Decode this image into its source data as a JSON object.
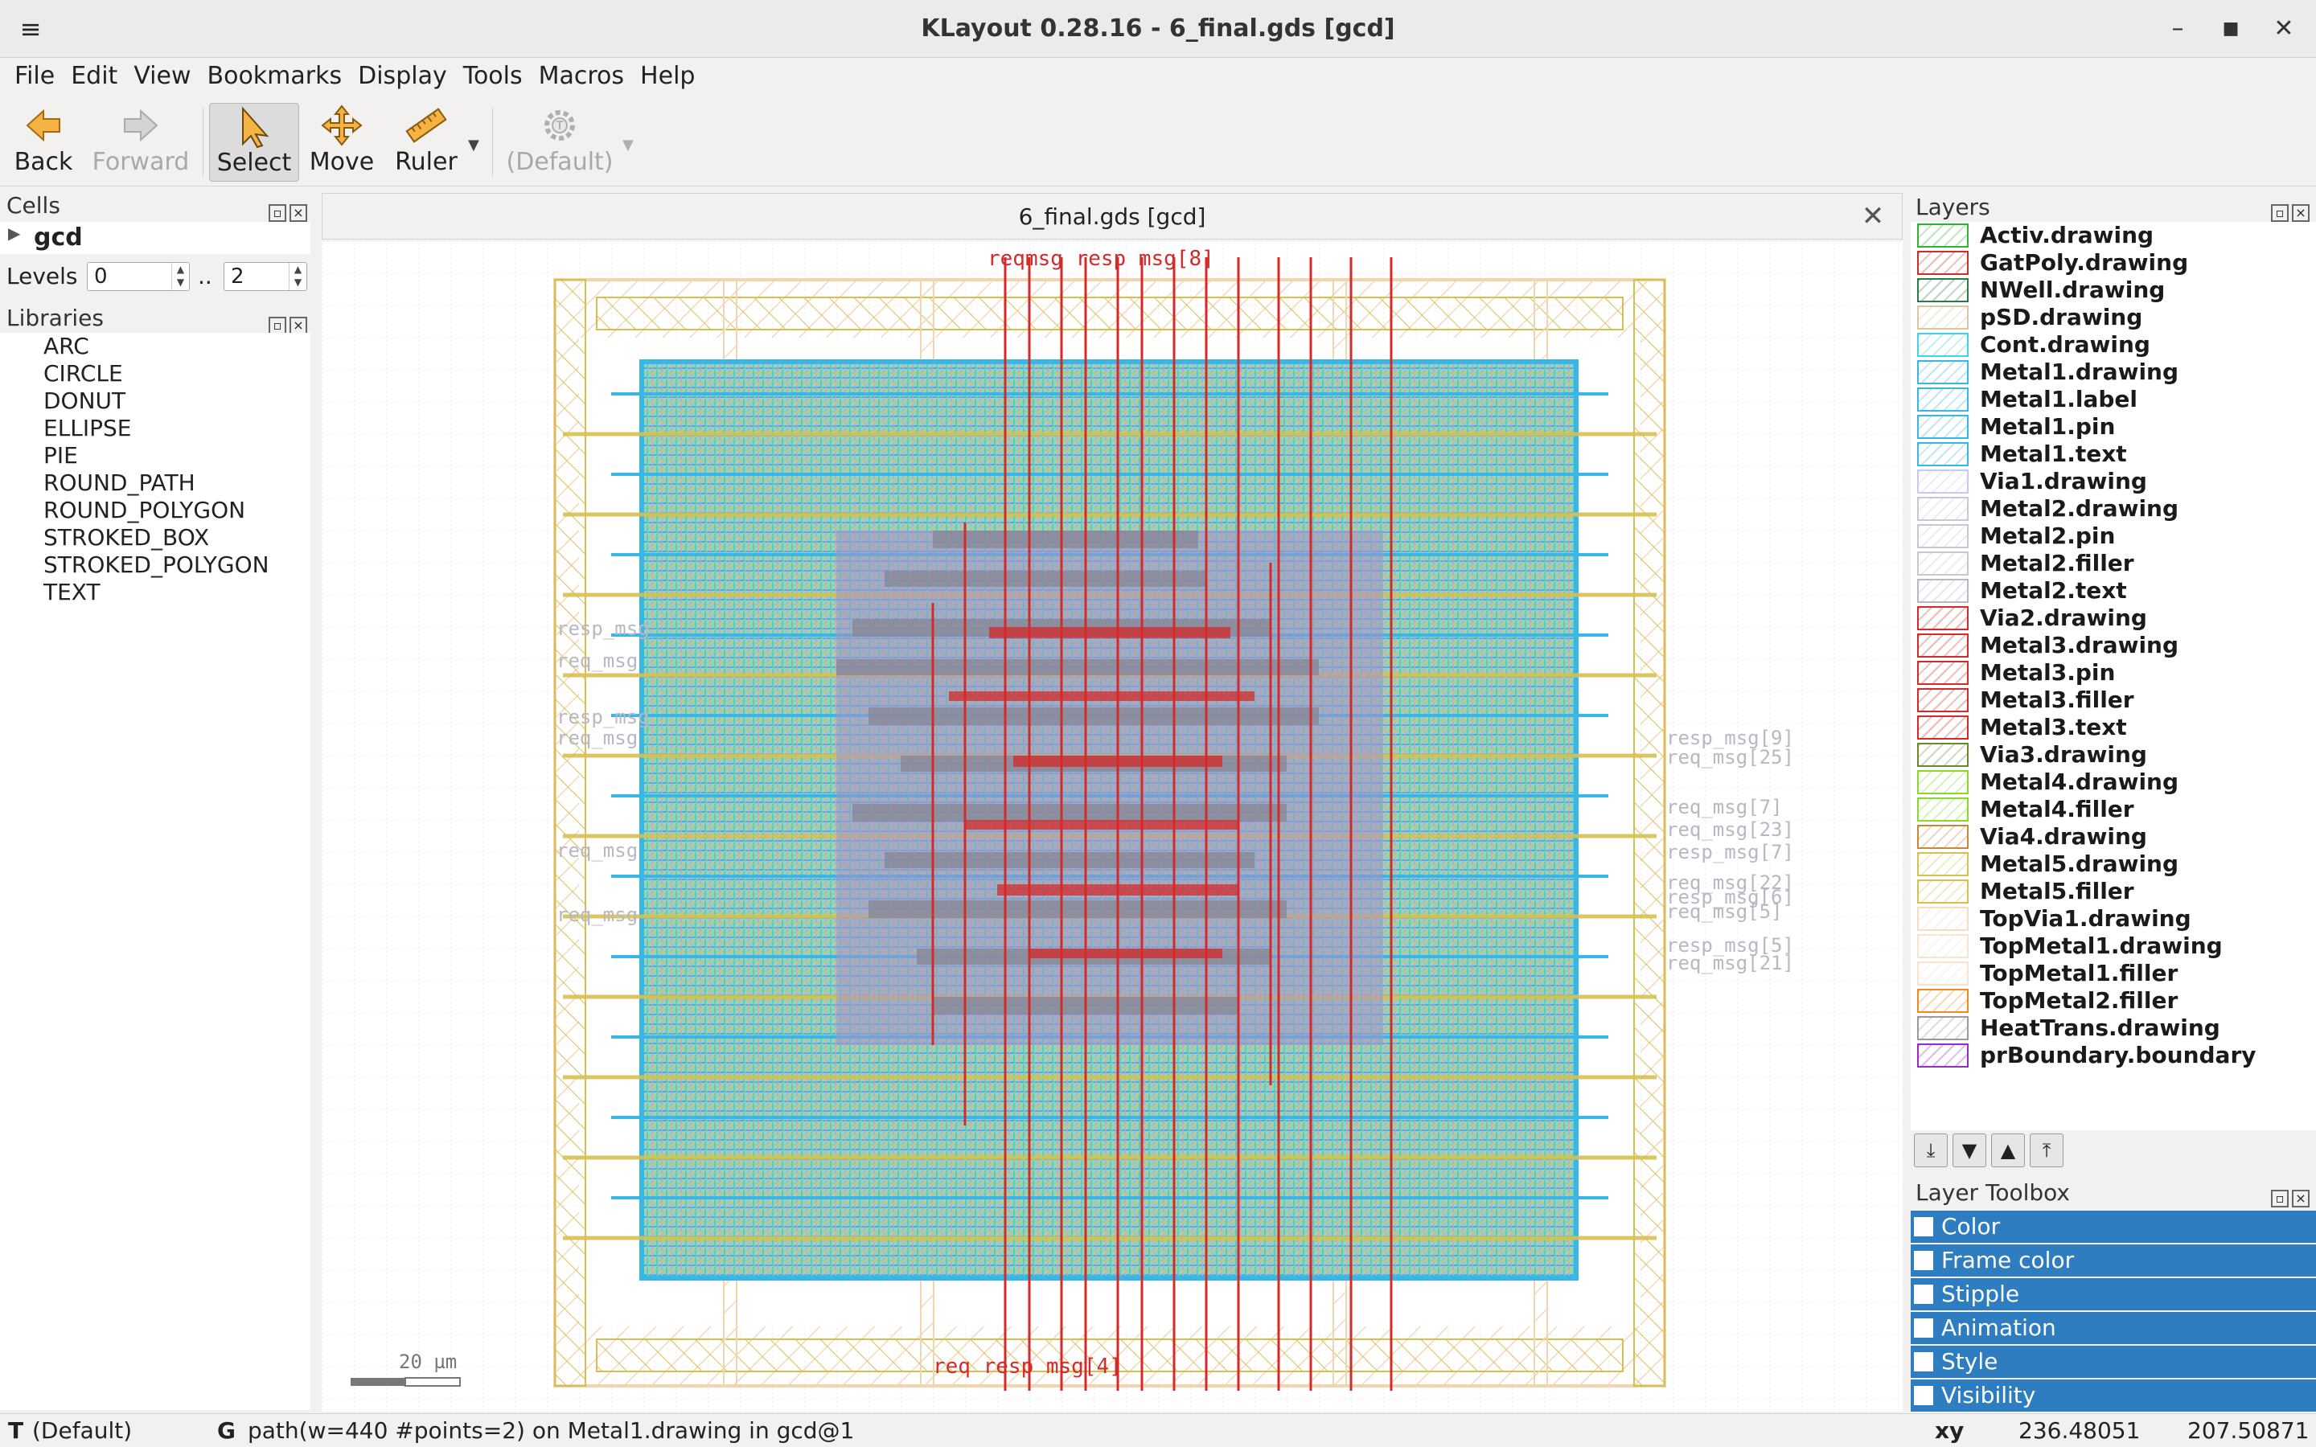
{
  "window": {
    "title": "KLayout 0.28.16 - 6_final.gds [gcd]"
  },
  "menu": [
    "File",
    "Edit",
    "View",
    "Bookmarks",
    "Display",
    "Tools",
    "Macros",
    "Help"
  ],
  "toolbar": {
    "back": "Back",
    "forward": "Forward",
    "select": "Select",
    "move": "Move",
    "ruler": "Ruler",
    "default": "(Default)"
  },
  "cells": {
    "title": "Cells",
    "root": "gcd"
  },
  "levels": {
    "label": "Levels",
    "from": "0",
    "sep": "..",
    "to": "2"
  },
  "libraries": {
    "title": "Libraries",
    "items": [
      "ARC",
      "CIRCLE",
      "DONUT",
      "ELLIPSE",
      "PIE",
      "ROUND_PATH",
      "ROUND_POLYGON",
      "STROKED_BOX",
      "STROKED_POLYGON",
      "TEXT"
    ]
  },
  "tab": {
    "title": "6_final.gds [gcd]"
  },
  "canvas": {
    "scale_label": "20 µm",
    "top_label": "reqmsg resp msg[8]",
    "bottom_label": "req resp msg[4]",
    "right_labels": [
      "resp_msg[9]",
      "req_msg[25]",
      "req_msg[7]",
      "req_msg[23]",
      "resp_msg[7]",
      "req_msg[22]",
      "resp_msg[6]",
      "req_msg[5]",
      "resp_msg[5]",
      "req_msg[21]"
    ],
    "left_labels": [
      "resp_msg",
      "req_msg",
      "resp_msg",
      "req_msg",
      "req_msg",
      "req_msg"
    ]
  },
  "layers": {
    "title": "Layers",
    "items": [
      {
        "name": "Activ.drawing",
        "color": "#2fb52f"
      },
      {
        "name": "GatPoly.drawing",
        "color": "#c8302a"
      },
      {
        "name": "NWell.drawing",
        "color": "#2a7a4c"
      },
      {
        "name": "pSD.drawing",
        "color": "#d8c7a0"
      },
      {
        "name": "Cont.drawing",
        "color": "#3fd4e6"
      },
      {
        "name": "Metal1.drawing",
        "color": "#38b6e8"
      },
      {
        "name": "Metal1.label",
        "color": "#38b6e8"
      },
      {
        "name": "Metal1.pin",
        "color": "#38b6e8"
      },
      {
        "name": "Metal1.text",
        "color": "#38b6e8"
      },
      {
        "name": "Via1.drawing",
        "color": "#c8c8f0"
      },
      {
        "name": "Metal2.drawing",
        "color": "#c8c8d4"
      },
      {
        "name": "Metal2.pin",
        "color": "#c8c8d4"
      },
      {
        "name": "Metal2.filler",
        "color": "#c8c8d4"
      },
      {
        "name": "Metal2.text",
        "color": "#b8b8c4"
      },
      {
        "name": "Via2.drawing",
        "color": "#d42a2a"
      },
      {
        "name": "Metal3.drawing",
        "color": "#d42a2a"
      },
      {
        "name": "Metal3.pin",
        "color": "#d42a2a"
      },
      {
        "name": "Metal3.filler",
        "color": "#d42a2a"
      },
      {
        "name": "Metal3.text",
        "color": "#d42a2a"
      },
      {
        "name": "Via3.drawing",
        "color": "#6a8a2a"
      },
      {
        "name": "Metal4.drawing",
        "color": "#8ad82a"
      },
      {
        "name": "Metal4.filler",
        "color": "#8ad82a"
      },
      {
        "name": "Via4.drawing",
        "color": "#c8883a"
      },
      {
        "name": "Metal5.drawing",
        "color": "#d8c050"
      },
      {
        "name": "Metal5.filler",
        "color": "#d8c050"
      },
      {
        "name": "TopVia1.drawing",
        "color": "#f4dcc0"
      },
      {
        "name": "TopMetal1.drawing",
        "color": "#f4e4d0"
      },
      {
        "name": "TopMetal1.filler",
        "color": "#f4e4d0"
      },
      {
        "name": "TopMetal2.filler",
        "color": "#f08a20"
      },
      {
        "name": "HeatTrans.drawing",
        "color": "#9a9a9a"
      },
      {
        "name": "prBoundary.boundary",
        "color": "#9a2ad0"
      }
    ]
  },
  "layer_toolbox": {
    "title": "Layer Toolbox",
    "items": [
      "Color",
      "Frame color",
      "Stipple",
      "Animation",
      "Style",
      "Visibility"
    ]
  },
  "status": {
    "mode_key": "T",
    "mode": "(Default)",
    "info_key": "G",
    "info": "path(w=440 #points=2) on Metal1.drawing in gcd@1",
    "coord_key": "xy",
    "x": "236.48051",
    "y": "207.50871"
  }
}
